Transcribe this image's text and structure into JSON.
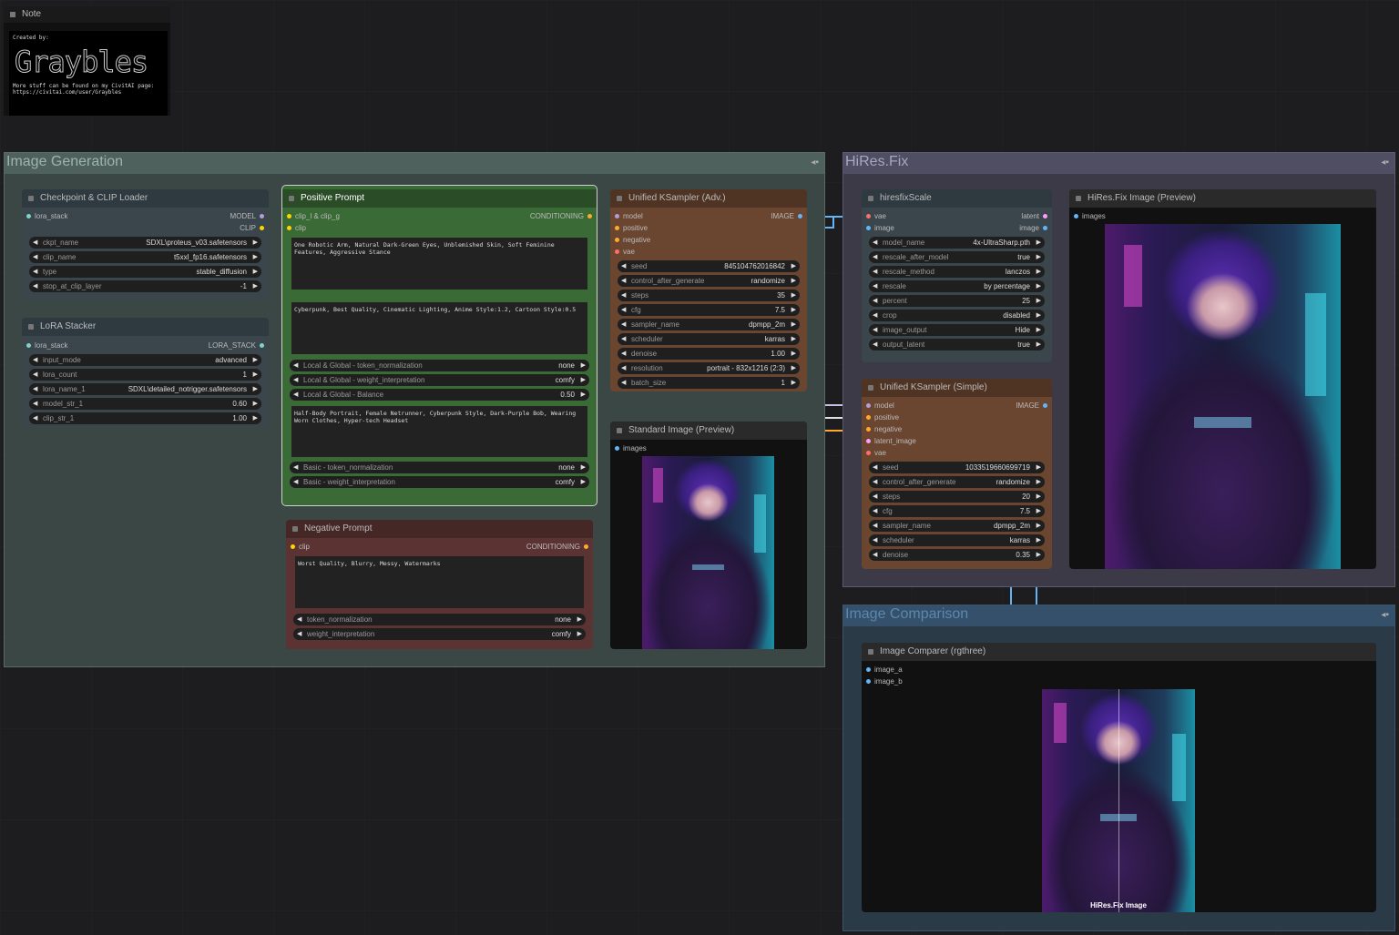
{
  "note": {
    "title": "Note",
    "created_by": "Created by:",
    "logo": "Graybles",
    "line1": "More stuff can be found on my CivitAI page:",
    "line2": "https://civitai.com/user/Graybles"
  },
  "groups": {
    "image_generation": "Image Generation",
    "hires_fix": "HiRes.Fix",
    "image_comparison": "Image Comparison"
  },
  "checkpoint": {
    "title": "Checkpoint & CLIP Loader",
    "in_lora_stack": "lora_stack",
    "out_model": "MODEL",
    "out_clip": "CLIP",
    "widgets": [
      {
        "label": "ckpt_name",
        "value": "SDXL\\proteus_v03.safetensors"
      },
      {
        "label": "clip_name",
        "value": "t5xxl_fp16.safetensors"
      },
      {
        "label": "type",
        "value": "stable_diffusion"
      },
      {
        "label": "stop_at_clip_layer",
        "value": "-1"
      }
    ]
  },
  "lora": {
    "title": "LoRA Stacker",
    "in_lora_stack": "lora_stack",
    "out_lora_stack": "LORA_STACK",
    "widgets": [
      {
        "label": "input_mode",
        "value": "advanced"
      },
      {
        "label": "lora_count",
        "value": "1"
      },
      {
        "label": "lora_name_1",
        "value": "SDXL\\detailed_notrigger.safetensors"
      },
      {
        "label": "model_str_1",
        "value": "0.60"
      },
      {
        "label": "clip_str_1",
        "value": "1.00"
      }
    ]
  },
  "positive": {
    "title": "Positive Prompt",
    "in_clip_lg": "clip_l & clip_g",
    "in_clip": "clip",
    "out_conditioning": "CONDITIONING",
    "text_l": "One Robotic Arm, Natural Dark-Green Eyes, Unblemished Skin, Soft Feminine Features, Aggressive Stance",
    "text_g": "Cyberpunk, Best Quality, Cinematic Lighting, Anime Style:1.2, Cartoon Style:0.5",
    "widgets_lg": [
      {
        "label": "Local & Global - token_normalization",
        "value": "none"
      },
      {
        "label": "Local & Global - weight_interpretation",
        "value": "comfy"
      },
      {
        "label": "Local & Global - Balance",
        "value": "0.50"
      }
    ],
    "text_basic": "Half-Body Portrait, Female Netrunner, Cyberpunk Style, Dark-Purple Bob, Wearing Worn Clothes, Hyper-tech Headset",
    "widgets_basic": [
      {
        "label": "Basic - token_normalization",
        "value": "none"
      },
      {
        "label": "Basic - weight_interpretation",
        "value": "comfy"
      }
    ]
  },
  "negative": {
    "title": "Negative Prompt",
    "in_clip": "clip",
    "out_conditioning": "CONDITIONING",
    "text": "Worst Quality, Blurry, Messy, Watermarks",
    "widgets": [
      {
        "label": "token_normalization",
        "value": "none"
      },
      {
        "label": "weight_interpretation",
        "value": "comfy"
      }
    ]
  },
  "ksampler_adv": {
    "title": "Unified KSampler (Adv.)",
    "inputs": [
      "model",
      "positive",
      "negative",
      "vae"
    ],
    "out_image": "IMAGE",
    "widgets": [
      {
        "label": "seed",
        "value": "845104762016842"
      },
      {
        "label": "control_after_generate",
        "value": "randomize"
      },
      {
        "label": "steps",
        "value": "35"
      },
      {
        "label": "cfg",
        "value": "7.5"
      },
      {
        "label": "sampler_name",
        "value": "dpmpp_2m"
      },
      {
        "label": "scheduler",
        "value": "karras"
      },
      {
        "label": "denoise",
        "value": "1.00"
      },
      {
        "label": "resolution",
        "value": "portrait - 832x1216 (2:3)"
      },
      {
        "label": "batch_size",
        "value": "1"
      }
    ]
  },
  "standard_preview": {
    "title": "Standard Image (Preview)",
    "in_images": "images"
  },
  "hiresfix_scale": {
    "title": "hiresfixScale",
    "in_vae": "vae",
    "in_image": "image",
    "out_latent": "latent",
    "out_image": "image",
    "widgets": [
      {
        "label": "model_name",
        "value": "4x-UltraSharp.pth"
      },
      {
        "label": "rescale_after_model",
        "value": "true"
      },
      {
        "label": "rescale_method",
        "value": "lanczos"
      },
      {
        "label": "rescale",
        "value": "by percentage"
      },
      {
        "label": "percent",
        "value": "25"
      },
      {
        "label": "crop",
        "value": "disabled"
      },
      {
        "label": "image_output",
        "value": "Hide"
      },
      {
        "label": "output_latent",
        "value": "true"
      }
    ]
  },
  "hires_preview": {
    "title": "HiRes.Fix Image (Preview)",
    "in_images": "images"
  },
  "ksampler_simple": {
    "title": "Unified KSampler (Simple)",
    "inputs": [
      "model",
      "positive",
      "negative",
      "latent_image",
      "vae"
    ],
    "out_image": "IMAGE",
    "widgets": [
      {
        "label": "seed",
        "value": "1033519660699719"
      },
      {
        "label": "control_after_generate",
        "value": "randomize"
      },
      {
        "label": "steps",
        "value": "20"
      },
      {
        "label": "cfg",
        "value": "7.5"
      },
      {
        "label": "sampler_name",
        "value": "dpmpp_2m"
      },
      {
        "label": "scheduler",
        "value": "karras"
      },
      {
        "label": "denoise",
        "value": "0.35"
      }
    ]
  },
  "comparer": {
    "title": "Image Comparer (rgthree)",
    "in_image_a": "image_a",
    "in_image_b": "image_b",
    "overlay_label": "HiRes.Fix Image"
  },
  "colors": {
    "wire_clip": "#ffd500",
    "wire_model": "#b39ddb",
    "wire_image": "#64b5f6",
    "wire_cond": "#ffa931",
    "wire_latent": "#ff9cf9",
    "wire_vae": "#ff6e6e"
  }
}
